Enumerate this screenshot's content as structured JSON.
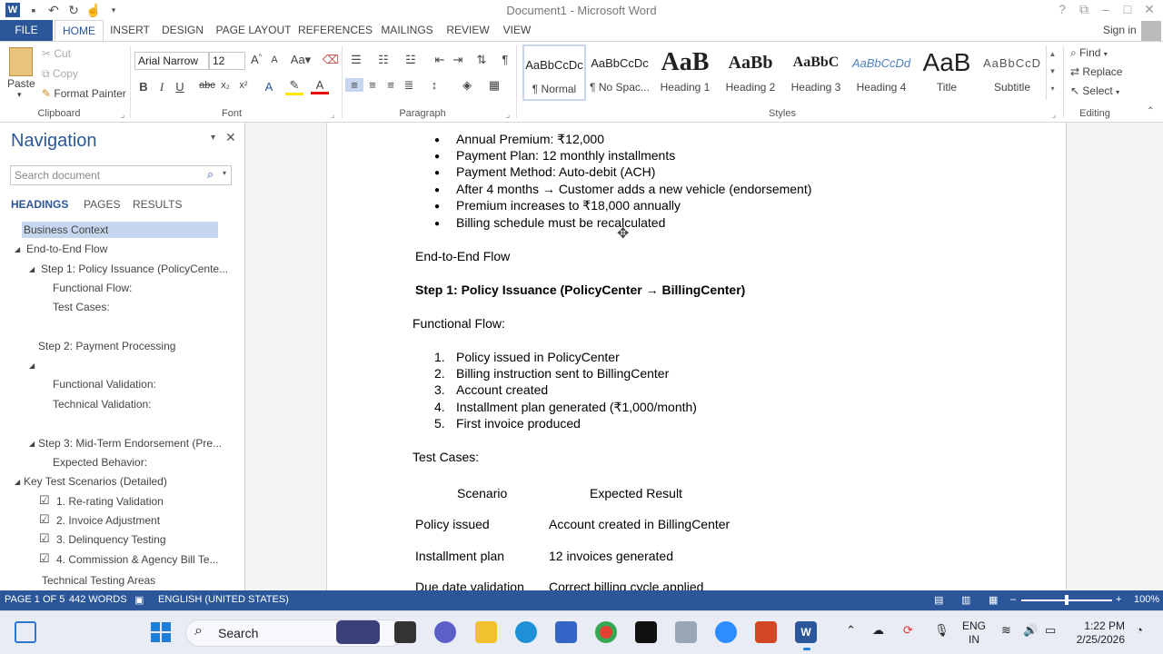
{
  "window": {
    "title": "Document1 - Microsoft Word",
    "signin": "Sign in"
  },
  "ribbon_tabs": [
    "FILE",
    "HOME",
    "INSERT",
    "DESIGN",
    "PAGE LAYOUT",
    "REFERENCES",
    "MAILINGS",
    "REVIEW",
    "VIEW"
  ],
  "clipboard": {
    "paste": "Paste",
    "cut": "Cut",
    "copy": "Copy",
    "format_painter": "Format Painter",
    "group": "Clipboard"
  },
  "font": {
    "name": "Arial Narrow",
    "size": "12",
    "group": "Font"
  },
  "paragraph": {
    "group": "Paragraph"
  },
  "styles": {
    "group": "Styles",
    "items": [
      {
        "preview": "AaBbCcDc",
        "name": "¶ Normal"
      },
      {
        "preview": "AaBbCcDc",
        "name": "¶ No Spac..."
      },
      {
        "preview": "AaB",
        "name": "Heading 1"
      },
      {
        "preview": "AaBb",
        "name": "Heading 2"
      },
      {
        "preview": "AaBbC",
        "name": "Heading 3"
      },
      {
        "preview": "AaBbCcDd",
        "name": "Heading 4"
      },
      {
        "preview": "AaB",
        "name": "Title"
      },
      {
        "preview": "AaBbCcD",
        "name": "Subtitle"
      }
    ]
  },
  "editing": {
    "find": "Find",
    "replace": "Replace",
    "select": "Select",
    "group": "Editing"
  },
  "navigation": {
    "title": "Navigation",
    "search_placeholder": "Search document",
    "tabs": [
      "HEADINGS",
      "PAGES",
      "RESULTS"
    ],
    "items": [
      "Business Context",
      "End-to-End Flow",
      "Step 1: Policy Issuance (PolicyCente...",
      "Functional Flow:",
      "Test Cases:",
      "Step 2: Payment Processing",
      "Functional Validation:",
      "Technical Validation:",
      "Step 3: Mid-Term Endorsement (Pre...",
      "Expected Behavior:",
      "Key Test Scenarios (Detailed)",
      "1. Re-rating Validation",
      "2. Invoice Adjustment",
      "3. Delinquency Testing",
      "4. Commission & Agency Bill Te...",
      "Technical Testing Areas"
    ]
  },
  "document": {
    "bullets": [
      "Annual Premium: ₹12,000",
      "Payment Plan: 12 monthly installments",
      "Payment Method: Auto-debit (ACH)",
      "After 4 months → Customer adds a new vehicle (endorsement)",
      "Premium increases to ₹18,000 annually",
      "Billing schedule must be recalculated"
    ],
    "e2e_heading": "End-to-End Flow",
    "step1_heading": "Step 1: Policy Issuance (PolicyCenter → BillingCenter)",
    "functional_flow": "Functional Flow:",
    "numbered": [
      "Policy issued in PolicyCenter",
      "Billing instruction sent to BillingCenter",
      "Account created",
      "Installment plan generated (₹1,000/month)",
      "First invoice produced"
    ],
    "test_cases": "Test Cases:",
    "table": {
      "headers": [
        "Scenario",
        "Expected Result"
      ],
      "rows": [
        [
          "Policy issued",
          "Account created in BillingCenter"
        ],
        [
          "Installment plan",
          "12 invoices generated"
        ],
        [
          "Due date validation",
          "Correct billing cycle applied"
        ]
      ]
    }
  },
  "status": {
    "page": "PAGE 1 OF 5",
    "words": "442 WORDS",
    "lang": "ENGLISH (UNITED STATES)",
    "zoom": "100%"
  },
  "taskbar": {
    "search": "Search",
    "lang1": "ENG",
    "lang2": "IN",
    "time": "1:22 PM",
    "date": "2/25/2026"
  }
}
